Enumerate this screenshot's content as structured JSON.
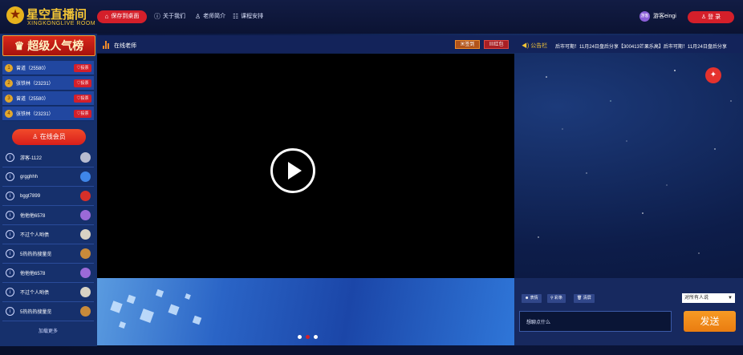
{
  "header": {
    "logo_title": "星空直播间",
    "logo_subtitle": "XINGKONGLIVE ROOM",
    "nav": [
      {
        "label": "保存到桌面",
        "icon": "home-icon"
      },
      {
        "label": "关于我们",
        "icon": "info-icon"
      },
      {
        "label": "老师简介",
        "icon": "user-icon"
      },
      {
        "label": "课程安排",
        "icon": "schedule-icon"
      }
    ],
    "user_avatar": "游客",
    "user_name": "游客eingi",
    "login_label": "登 录"
  },
  "ranking": {
    "banner": "超级人气榜",
    "vote_label": "投票",
    "rows": [
      {
        "rank": "1",
        "name": "曾道（25580）"
      },
      {
        "rank": "2",
        "name": "张铁林（23231）"
      },
      {
        "rank": "3",
        "name": "曾道（25580）"
      },
      {
        "rank": "4",
        "name": "张铁林（23231）"
      }
    ]
  },
  "members": {
    "online_button": "在线会员",
    "list": [
      {
        "name": "游客-1122",
        "badge_color": "#b8bcd0"
      },
      {
        "name": "grgghhh",
        "badge_color": "#3f86e8"
      },
      {
        "name": "bggt7899",
        "badge_color": "#d6302a"
      },
      {
        "name": "他他他6578",
        "badge_color": "#9b6ad8"
      },
      {
        "name": "不过个人哟债",
        "badge_color": "#d8d2c4"
      },
      {
        "name": "5热热热搜量览",
        "badge_color": "#c88a3a"
      },
      {
        "name": "他他他6578",
        "badge_color": "#9b6ad8"
      },
      {
        "name": "不过个人哟债",
        "badge_color": "#d8d2c4"
      },
      {
        "name": "5热热热搜量览",
        "badge_color": "#c88a3a"
      }
    ],
    "load_more": "加载更多"
  },
  "stage": {
    "teacher_label": "在线老师",
    "sign_in": "签到",
    "red_packet": "红包"
  },
  "notice": {
    "label": "公告栏",
    "text": "后市可期！11月24日盘后分享【300413芒果乐高】后市可期！11月24日盘后分享"
  },
  "chat": {
    "tools": [
      "表情",
      "彩条",
      "清屏"
    ],
    "target": "对所有人说",
    "placeholder": "想聊点什么",
    "send": "发送"
  },
  "colors": {
    "accent_red": "#d41f2a",
    "accent_orange": "#f08a2a",
    "gold": "#f3c536"
  }
}
